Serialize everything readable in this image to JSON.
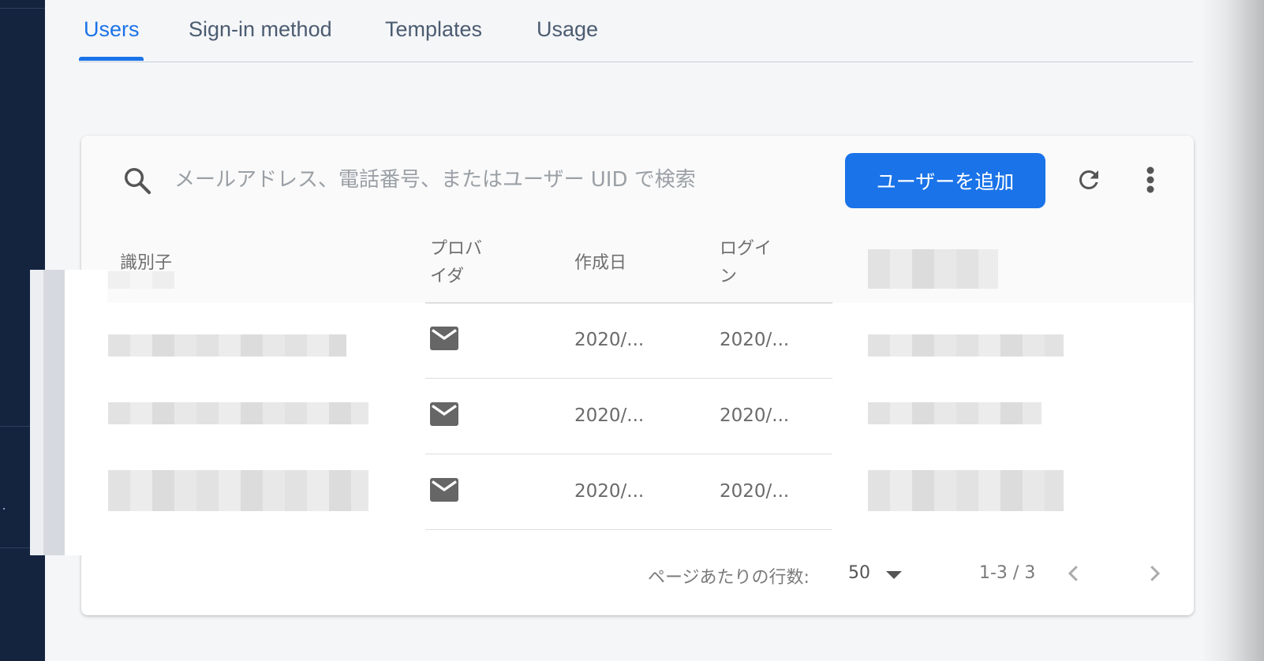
{
  "tabs": [
    {
      "label": "Users",
      "active": true
    },
    {
      "label": "Sign-in method",
      "active": false
    },
    {
      "label": "Templates",
      "active": false
    },
    {
      "label": "Usage",
      "active": false
    }
  ],
  "search": {
    "placeholder": "メールアドレス、電話番号、またはユーザー UID で検索",
    "icon": "search-icon"
  },
  "toolbar": {
    "add_user_label": "ユーザーを追加",
    "refresh_icon": "refresh-icon",
    "more_icon": "more-vert-icon"
  },
  "table": {
    "columns": {
      "identifier": "識別子",
      "provider_line1": "プロバ",
      "provider_line2": "イダ",
      "created": "作成日",
      "login_line1": "ログイ",
      "login_line2": "ン"
    },
    "rows": [
      {
        "provider_icon": "mail-icon",
        "created": "2020/...",
        "login": "2020/..."
      },
      {
        "provider_icon": "mail-icon",
        "created": "2020/...",
        "login": "2020/..."
      },
      {
        "provider_icon": "mail-icon",
        "created": "2020/...",
        "login": "2020/..."
      }
    ]
  },
  "pagination": {
    "rows_per_page_label": "ページあたりの行数:",
    "rows_per_page_value": "50",
    "range": "1-3 / 3",
    "prev_icon": "chevron-left-icon",
    "next_icon": "chevron-right-icon"
  },
  "colors": {
    "accent": "#1a73e8",
    "sidebar": "#14243f",
    "background": "#f5f6f8"
  }
}
